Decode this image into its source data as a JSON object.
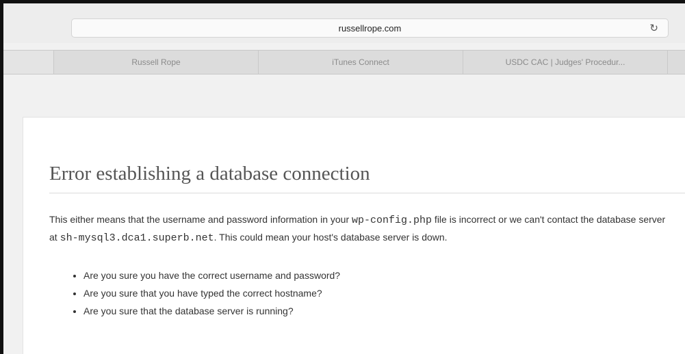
{
  "browser": {
    "url": "russellrope.com",
    "reload_icon": "reload-icon",
    "tabs": [
      {
        "label": "Russell Rope"
      },
      {
        "label": "iTunes Connect"
      },
      {
        "label": "USDC CAC | Judges' Procedur..."
      }
    ]
  },
  "page": {
    "title": "Error establishing a database connection",
    "paragraph": {
      "part1": "This either means that the username and password information in your ",
      "code1": "wp-config.php",
      "part2": " file is incorrect or we can't contact the database server at ",
      "code2": "sh-mysql3.dca1.superb.net",
      "part3": ". This could mean your host's database server is down."
    },
    "bullets": [
      "Are you sure you have the correct username and password?",
      "Are you sure that you have typed the correct hostname?",
      "Are you sure that the database server is running?"
    ]
  }
}
